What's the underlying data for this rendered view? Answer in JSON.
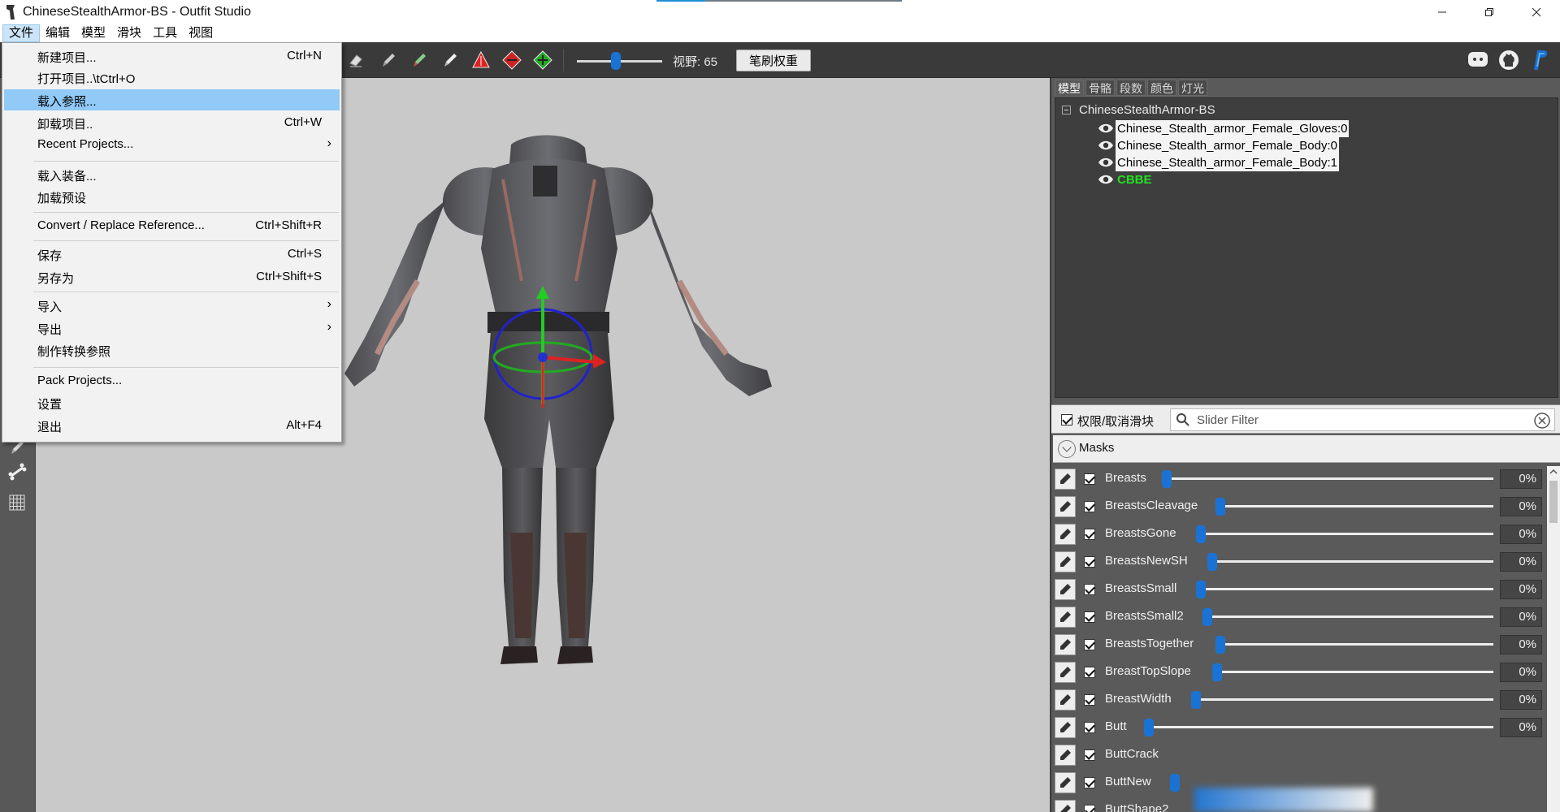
{
  "window": {
    "title": "ChineseStealthArmor-BS - Outfit Studio",
    "controls": [
      "minimize",
      "maximize",
      "close"
    ]
  },
  "menubar": {
    "items": [
      "文件",
      "编辑",
      "模型",
      "滑块",
      "工具",
      "视图"
    ],
    "active": "文件"
  },
  "toolbar": {
    "fov_label": "视野: 65",
    "fov_value": 65,
    "brush_weight_button": "笔刷权重",
    "icons": [
      "eraser-icon",
      "brush-icon",
      "color-brush-icon",
      "smooth-brush-icon",
      "move-tool-icon",
      "rotate-tool-icon",
      "scale-tool-icon"
    ],
    "right_icons": [
      "discord-icon",
      "github-icon",
      "paypal-icon"
    ]
  },
  "file_menu": {
    "items": [
      {
        "label": "新建项目...",
        "shortcut": "Ctrl+N"
      },
      {
        "label": "打开项目..\\tCtrl+O",
        "shortcut": ""
      },
      {
        "label": "载入参照...",
        "shortcut": "",
        "highlighted": true
      },
      {
        "label": "卸载项目..",
        "shortcut": "Ctrl+W"
      },
      {
        "label": "Recent Projects...",
        "shortcut": "",
        "submenu": true
      },
      {
        "label": "载入装备...",
        "shortcut": ""
      },
      {
        "label": "加载预设",
        "shortcut": ""
      },
      {
        "label": "Convert / Replace Reference...",
        "shortcut": "Ctrl+Shift+R"
      },
      {
        "label": "保存",
        "shortcut": "Ctrl+S"
      },
      {
        "label": "另存为",
        "shortcut": "Ctrl+Shift+S"
      },
      {
        "label": "导入",
        "shortcut": "",
        "submenu": true
      },
      {
        "label": "导出",
        "shortcut": "",
        "submenu": true
      },
      {
        "label": "制作转换参照",
        "shortcut": ""
      },
      {
        "label": "Pack Projects...",
        "shortcut": ""
      },
      {
        "label": "设置",
        "shortcut": ""
      },
      {
        "label": "退出",
        "shortcut": "Alt+F4"
      }
    ]
  },
  "right_panel": {
    "tabs": [
      "模型",
      "骨骼",
      "段数",
      "颜色",
      "灯光"
    ],
    "active_tab": "模型",
    "tree": {
      "root": "ChineseStealthArmor-BS",
      "items": [
        "Chinese_Stealth_armor_Female_Gloves:0",
        "Chinese_Stealth_armor_Female_Body:0",
        "Chinese_Stealth_armor_Female_Body:1",
        "CBBE"
      ]
    },
    "filter": {
      "checkbox_label": "权限/取消滑块",
      "placeholder": "Slider Filter"
    },
    "masks_label": "Masks",
    "sliders": [
      {
        "name": "Breasts",
        "value": "0%"
      },
      {
        "name": "BreastsCleavage",
        "value": "0%"
      },
      {
        "name": "BreastsGone",
        "value": "0%"
      },
      {
        "name": "BreastsNewSH",
        "value": "0%"
      },
      {
        "name": "BreastsSmall",
        "value": "0%"
      },
      {
        "name": "BreastsSmall2",
        "value": "0%"
      },
      {
        "name": "BreastsTogether",
        "value": "0%"
      },
      {
        "name": "BreastTopSlope",
        "value": "0%"
      },
      {
        "name": "BreastWidth",
        "value": "0%"
      },
      {
        "name": "Butt",
        "value": "0%"
      },
      {
        "name": "ButtCrack",
        "value": ""
      },
      {
        "name": "ButtNew",
        "value": ""
      },
      {
        "name": "ButtShape2",
        "value": ""
      }
    ]
  },
  "colors": {
    "accent": "#1a73d4",
    "highlight": "#91c9f7",
    "reference_text": "#22e022"
  }
}
